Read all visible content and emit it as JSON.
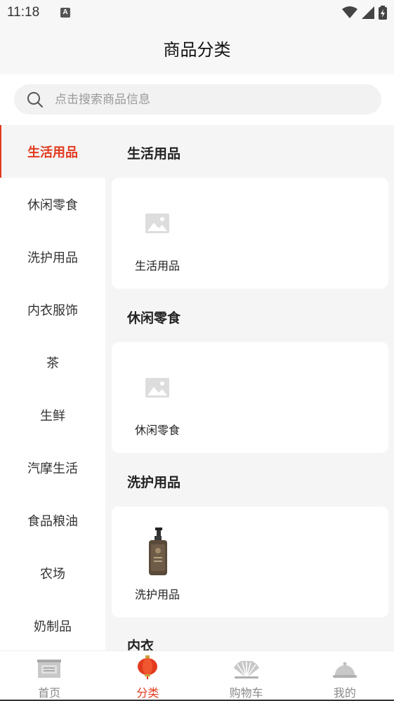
{
  "status_bar": {
    "time": "11:18",
    "app_indicator": "A"
  },
  "header": {
    "title": "商品分类"
  },
  "search": {
    "placeholder": "点击搜索商品信息"
  },
  "sidebar": {
    "items": [
      {
        "label": "生活用品",
        "active": true
      },
      {
        "label": "休闲零食",
        "active": false
      },
      {
        "label": "洗护用品",
        "active": false
      },
      {
        "label": "内衣服饰",
        "active": false
      },
      {
        "label": "茶",
        "active": false
      },
      {
        "label": "生鲜",
        "active": false
      },
      {
        "label": "汽摩生活",
        "active": false
      },
      {
        "label": "食品粮油",
        "active": false
      },
      {
        "label": "农场",
        "active": false
      },
      {
        "label": "奶制品",
        "active": false
      }
    ]
  },
  "content": {
    "sections": [
      {
        "title": "生活用品",
        "items": [
          {
            "label": "生活用品",
            "icon": "image-placeholder-icon"
          }
        ]
      },
      {
        "title": "休闲零食",
        "items": [
          {
            "label": "休闲零食",
            "icon": "image-placeholder-icon"
          }
        ]
      },
      {
        "title": "洗护用品",
        "items": [
          {
            "label": "洗护用品",
            "icon": "shampoo-bottle-icon"
          }
        ]
      },
      {
        "title": "内衣"
      }
    ]
  },
  "tabbar": {
    "tabs": [
      {
        "label": "首页",
        "icon": "home-gate-icon",
        "active": false
      },
      {
        "label": "分类",
        "icon": "lantern-icon",
        "active": true
      },
      {
        "label": "购物车",
        "icon": "fan-icon",
        "active": false
      },
      {
        "label": "我的",
        "icon": "dish-cover-icon",
        "active": false
      }
    ]
  },
  "colors": {
    "accent": "#e23a1e",
    "background": "#f5f5f5",
    "card": "#ffffff"
  }
}
